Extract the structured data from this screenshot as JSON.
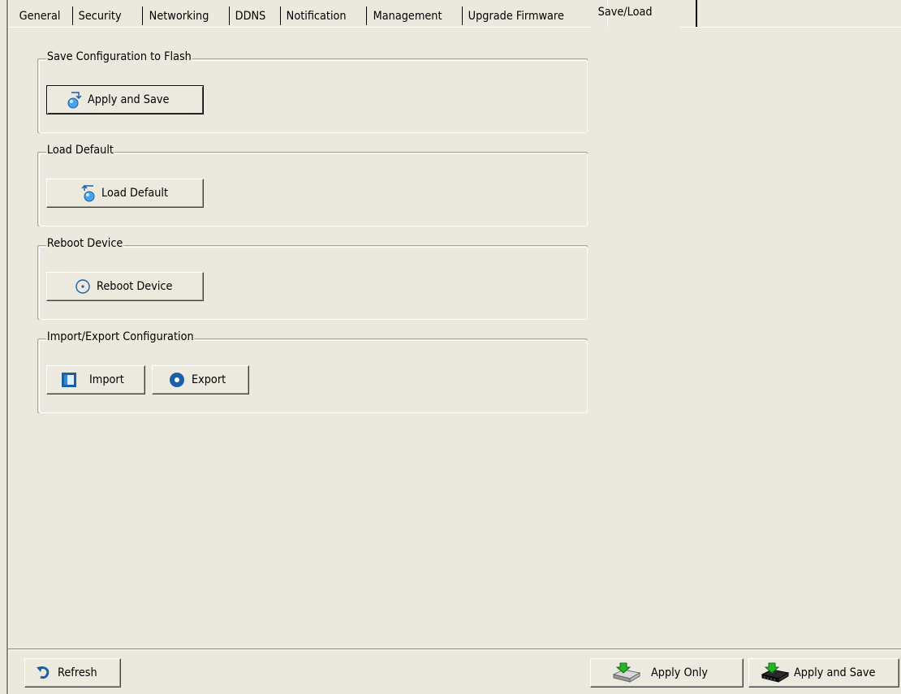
{
  "tabs": [
    {
      "label": "General"
    },
    {
      "label": "Security"
    },
    {
      "label": "Networking"
    },
    {
      "label": "DDNS"
    },
    {
      "label": "Notification"
    },
    {
      "label": "Management"
    },
    {
      "label": "Upgrade Firmware"
    },
    {
      "label": "Save/Load",
      "active": true
    }
  ],
  "groups": {
    "save_flash": {
      "title": "Save Configuration to Flash",
      "button": "Apply and Save"
    },
    "load_default": {
      "title": "Load Default",
      "button": "Load Default"
    },
    "reboot": {
      "title": "Reboot Device",
      "button": "Reboot Device"
    },
    "import_export": {
      "title": "Import/Export Configuration",
      "import_button": "Import",
      "export_button": "Export"
    }
  },
  "footer": {
    "refresh": "Refresh",
    "apply_only": "Apply Only",
    "apply_and_save": "Apply and Save"
  },
  "colors": {
    "background": "#ebe8dd",
    "icon_blue": "#1a5fa8"
  },
  "icons": {
    "apply_save": "save-arrow-icon",
    "load_default": "load-arrow-icon",
    "reboot": "reboot-circle-icon",
    "import": "import-icon",
    "export": "export-icon",
    "refresh": "refresh-icon",
    "apply_only": "drive-apply-icon",
    "apply_and_save": "chip-save-icon"
  }
}
